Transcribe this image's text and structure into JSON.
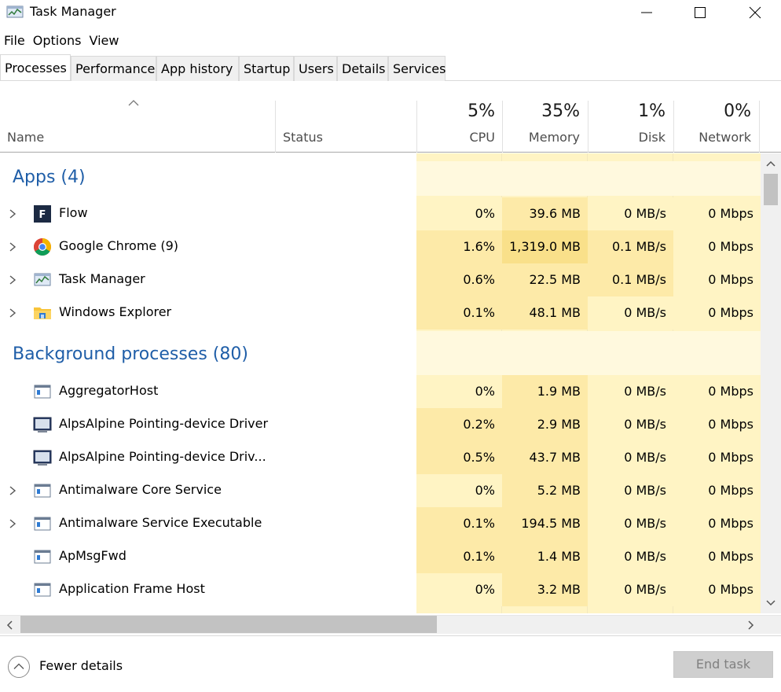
{
  "window": {
    "title": "Task Manager"
  },
  "menu": [
    "File",
    "Options",
    "View"
  ],
  "tabs": [
    "Processes",
    "Performance",
    "App history",
    "Startup",
    "Users",
    "Details",
    "Services"
  ],
  "columns": {
    "name": "Name",
    "status": "Status",
    "cpu": {
      "pct": "5%",
      "label": "CPU"
    },
    "memory": {
      "pct": "35%",
      "label": "Memory"
    },
    "disk": {
      "pct": "1%",
      "label": "Disk"
    },
    "network": {
      "pct": "0%",
      "label": "Network"
    }
  },
  "groups": {
    "apps": "Apps (4)",
    "background": "Background processes (80)"
  },
  "apps": [
    {
      "name": "Flow",
      "icon": "flow-icon",
      "expandable": true,
      "cpu": "0%",
      "memory": "39.6 MB",
      "disk": "0 MB/s",
      "network": "0 Mbps"
    },
    {
      "name": "Google Chrome (9)",
      "icon": "chrome-icon",
      "expandable": true,
      "cpu": "1.6%",
      "memory": "1,319.0 MB",
      "disk": "0.1 MB/s",
      "network": "0 Mbps"
    },
    {
      "name": "Task Manager",
      "icon": "task-manager-icon",
      "expandable": true,
      "cpu": "0.6%",
      "memory": "22.5 MB",
      "disk": "0.1 MB/s",
      "network": "0 Mbps"
    },
    {
      "name": "Windows Explorer",
      "icon": "folder-icon",
      "expandable": true,
      "cpu": "0.1%",
      "memory": "48.1 MB",
      "disk": "0 MB/s",
      "network": "0 Mbps"
    }
  ],
  "background": [
    {
      "name": "AggregatorHost",
      "icon": "service-window-icon",
      "expandable": false,
      "cpu": "0%",
      "memory": "1.9 MB",
      "disk": "0 MB/s",
      "network": "0 Mbps"
    },
    {
      "name": "AlpsAlpine Pointing-device Driver",
      "icon": "monitor-icon",
      "expandable": false,
      "cpu": "0.2%",
      "memory": "2.9 MB",
      "disk": "0 MB/s",
      "network": "0 Mbps"
    },
    {
      "name": "AlpsAlpine Pointing-device Driv...",
      "icon": "monitor-icon",
      "expandable": false,
      "cpu": "0.5%",
      "memory": "43.7 MB",
      "disk": "0 MB/s",
      "network": "0 Mbps"
    },
    {
      "name": "Antimalware Core Service",
      "icon": "service-window-icon",
      "expandable": true,
      "cpu": "0%",
      "memory": "5.2 MB",
      "disk": "0 MB/s",
      "network": "0 Mbps"
    },
    {
      "name": "Antimalware Service Executable",
      "icon": "service-window-icon",
      "expandable": true,
      "cpu": "0.1%",
      "memory": "194.5 MB",
      "disk": "0 MB/s",
      "network": "0 Mbps"
    },
    {
      "name": "ApMsgFwd",
      "icon": "service-window-icon",
      "expandable": false,
      "cpu": "0.1%",
      "memory": "1.4 MB",
      "disk": "0 MB/s",
      "network": "0 Mbps"
    },
    {
      "name": "Application Frame Host",
      "icon": "service-window-icon",
      "expandable": false,
      "cpu": "0%",
      "memory": "3.2 MB",
      "disk": "0 MB/s",
      "network": "0 Mbps"
    }
  ],
  "footer": {
    "fewer_details": "Fewer details",
    "end_task": "End task"
  },
  "colors": {
    "accent": "#1f5ea8",
    "heat_light": "#fff4c4",
    "heat_medium": "#fdeaa8",
    "heat_strong": "#f9e08a"
  }
}
